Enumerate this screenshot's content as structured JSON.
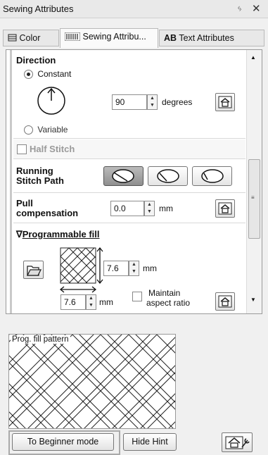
{
  "window": {
    "title": "Sewing Attributes",
    "pin_icon": "pin-icon",
    "close_icon": "close-icon"
  },
  "tabs": [
    {
      "label": "Color",
      "icon": "color-icon"
    },
    {
      "label": "Sewing Attribu...",
      "icon": "sewing-icon"
    },
    {
      "label": "Text Attributes",
      "icon": "text-icon",
      "icon_glyph": "AB"
    }
  ],
  "direction": {
    "heading": "Direction",
    "constant_label": "Constant",
    "variable_label": "Variable",
    "selected": "Constant",
    "value": "90",
    "unit": "degrees"
  },
  "half_stitch": {
    "label": "Half Stitch",
    "checked": false
  },
  "running_stitch": {
    "label_line1": "Running",
    "label_line2": "Stitch Path",
    "selected_index": 0
  },
  "pull_compensation": {
    "label_line1": "Pull",
    "label_line2": "compensation",
    "value": "0.0",
    "unit": "mm"
  },
  "programmable_fill": {
    "heading": "Programmable fill",
    "arrow": "∇",
    "height_value": "7.6",
    "height_unit": "mm",
    "width_value": "7.6",
    "width_unit": "mm",
    "maintain_line1": "Maintain",
    "maintain_line2": "aspect ratio",
    "maintain_checked": false
  },
  "hint": {
    "label": "Prog. fill pattern"
  },
  "footer": {
    "beginner_button": "To Beginner mode",
    "hide_hint_button": "Hide Hint"
  }
}
